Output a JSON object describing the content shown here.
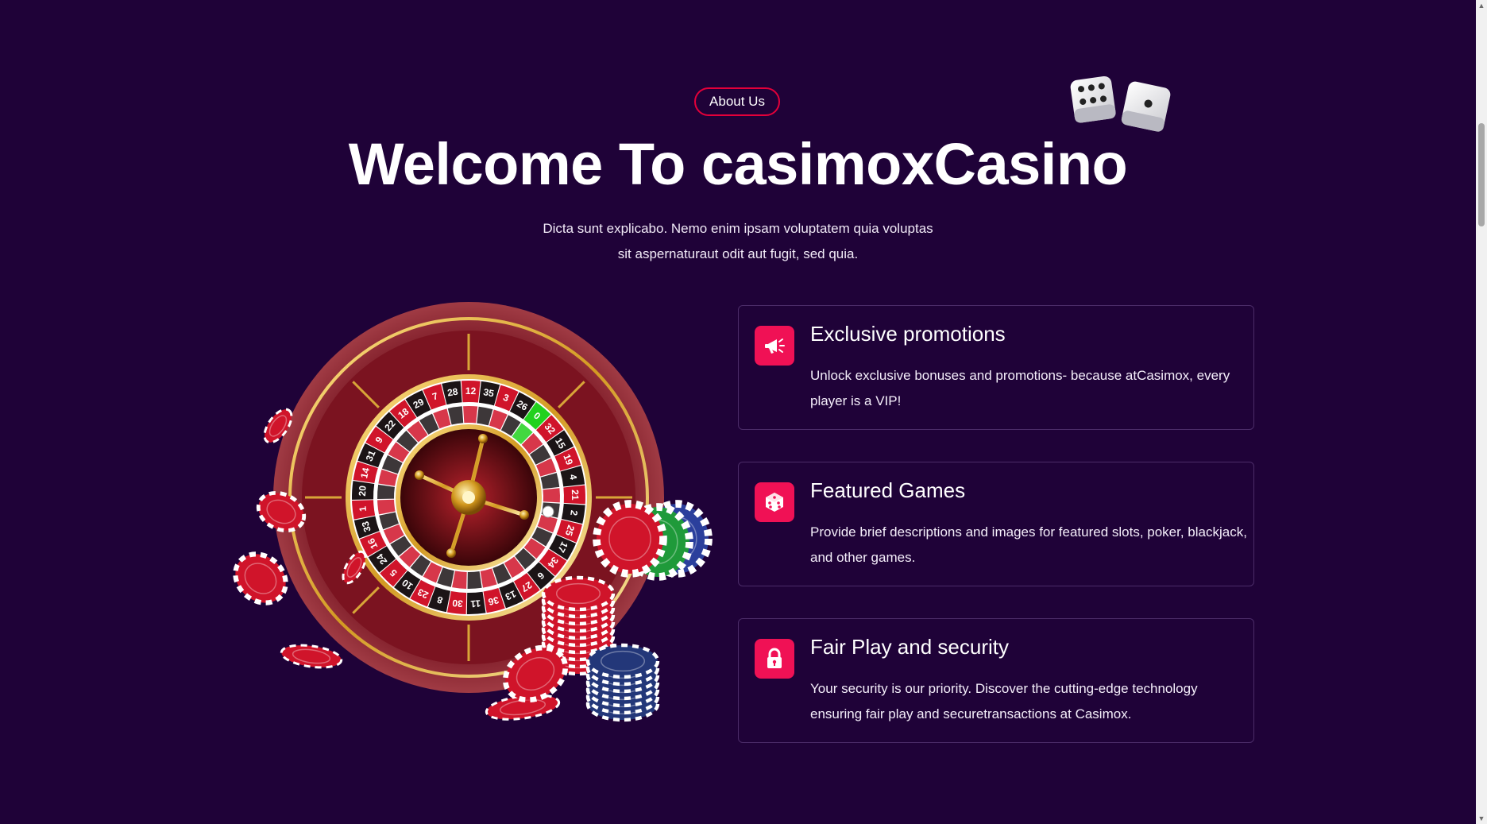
{
  "header": {
    "badge": "About Us",
    "title": "Welcome To casimoxCasino",
    "subtitle_line1": "Dicta sunt explicabo. Nemo enim ipsam voluptatem quia voluptas",
    "subtitle_line2": "sit aspernaturaut odit aut fugit, sed quia."
  },
  "features": [
    {
      "icon": "megaphone-icon",
      "title": "Exclusive promotions",
      "description": "Unlock exclusive bonuses and promotions- because atCasimox, every player is a VIP!"
    },
    {
      "icon": "dice-icon",
      "title": "Featured Games",
      "description": "Provide brief descriptions and images for featured slots, poker, blackjack, and other games."
    },
    {
      "icon": "lock-icon",
      "title": "Fair Play and security",
      "description": "Your security is our priority. Discover the cutting-edge technology ensuring fair play and securetransactions at Casimox."
    }
  ],
  "roulette": {
    "numbers": [
      "0",
      "32",
      "15",
      "19",
      "4",
      "21",
      "2",
      "25",
      "17",
      "34",
      "6",
      "27",
      "13",
      "36",
      "11",
      "30",
      "8",
      "23",
      "10",
      "5",
      "24",
      "16",
      "33",
      "1",
      "20",
      "14",
      "31",
      "9",
      "22",
      "18",
      "29",
      "7",
      "28",
      "12",
      "35",
      "3",
      "26"
    ]
  },
  "colors": {
    "background": "#1f0238",
    "accent": "#f01155",
    "badge_border": "#e3003a",
    "card_border": "#4b2c68"
  },
  "scrollbar": {
    "up_glyph": "▲",
    "down_glyph": "▼"
  }
}
